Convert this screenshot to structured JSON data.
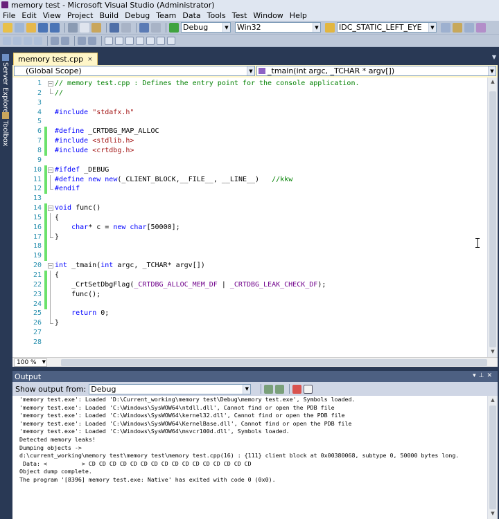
{
  "window": {
    "title": "memory test - Microsoft Visual Studio (Administrator)"
  },
  "menu": [
    "File",
    "Edit",
    "View",
    "Project",
    "Build",
    "Debug",
    "Team",
    "Data",
    "Tools",
    "Test",
    "Window",
    "Help"
  ],
  "toolbar": {
    "config": "Debug",
    "platform": "Win32",
    "find_target": "IDC_STATIC_LEFT_EYE"
  },
  "side_tabs": [
    "Server Explorer",
    "Toolbox"
  ],
  "tabs": [
    {
      "label": "memory test.cpp",
      "close": "×"
    }
  ],
  "scope": {
    "left": "(Global Scope)",
    "right": "_tmain(int argc, _TCHAR * argv[])"
  },
  "editor": {
    "zoom": "100 %",
    "lines": [
      {
        "n": "1",
        "t": "// memory test.cpp : Defines the entry point for the console application."
      },
      {
        "n": "2",
        "t": "//"
      },
      {
        "n": "3",
        "t": ""
      },
      {
        "n": "4",
        "t": "#include \"stdafx.h\""
      },
      {
        "n": "5",
        "t": ""
      },
      {
        "n": "6",
        "t": "#define _CRTDBG_MAP_ALLOC"
      },
      {
        "n": "7",
        "t": "#include <stdlib.h>"
      },
      {
        "n": "8",
        "t": "#include <crtdbg.h>"
      },
      {
        "n": "9",
        "t": ""
      },
      {
        "n": "10",
        "t": "#ifdef _DEBUG"
      },
      {
        "n": "11",
        "t": "#define new new(_CLIENT_BLOCK,__FILE__, __LINE__)   //kkw"
      },
      {
        "n": "12",
        "t": "#endif"
      },
      {
        "n": "13",
        "t": ""
      },
      {
        "n": "14",
        "t": "void func()"
      },
      {
        "n": "15",
        "t": "{"
      },
      {
        "n": "16",
        "t": "    char* c = new char[50000];"
      },
      {
        "n": "17",
        "t": "}"
      },
      {
        "n": "18",
        "t": ""
      },
      {
        "n": "19",
        "t": ""
      },
      {
        "n": "20",
        "t": "int _tmain(int argc, _TCHAR* argv[])"
      },
      {
        "n": "21",
        "t": "{"
      },
      {
        "n": "22",
        "t": "    _CrtSetDbgFlag(_CRTDBG_ALLOC_MEM_DF | _CRTDBG_LEAK_CHECK_DF);"
      },
      {
        "n": "23",
        "t": "    func();"
      },
      {
        "n": "24",
        "t": ""
      },
      {
        "n": "25",
        "t": "    return 0;"
      },
      {
        "n": "26",
        "t": "}"
      },
      {
        "n": "27",
        "t": ""
      },
      {
        "n": "28",
        "t": ""
      }
    ]
  },
  "output": {
    "title": "Output",
    "show_from_label": "Show output from:",
    "source": "Debug",
    "lines": [
      "'memory test.exe': Loaded 'D:\\Current_working\\memory test\\Debug\\memory test.exe', Symbols loaded.",
      "'memory test.exe': Loaded 'C:\\Windows\\SysWOW64\\ntdll.dll', Cannot find or open the PDB file",
      "'memory test.exe': Loaded 'C:\\Windows\\SysWOW64\\kernel32.dll', Cannot find or open the PDB file",
      "'memory test.exe': Loaded 'C:\\Windows\\SysWOW64\\KernelBase.dll', Cannot find or open the PDB file",
      "'memory test.exe': Loaded 'C:\\Windows\\SysWOW64\\msvcr100d.dll', Symbols loaded.",
      "Detected memory leaks!",
      "Dumping objects ->",
      "d:\\current_working\\memory test\\memory test\\memory test.cpp(16) : {111} client block at 0x00380068, subtype 0, 50000 bytes long.",
      " Data: <          > CD CD CD CD CD CD CD CD CD CD CD CD CD CD CD CD",
      "Object dump complete.",
      "The program '[8396] memory test.exe: Native' has exited with code 0 (0x0)."
    ]
  },
  "colors": {
    "frame": "#293955",
    "active_tab": "#fff6c8",
    "line_numbers": "#2b91af",
    "keyword": "#0000ff",
    "comment": "#008000",
    "string": "#a31515",
    "change_bar": "#6ce26c"
  }
}
